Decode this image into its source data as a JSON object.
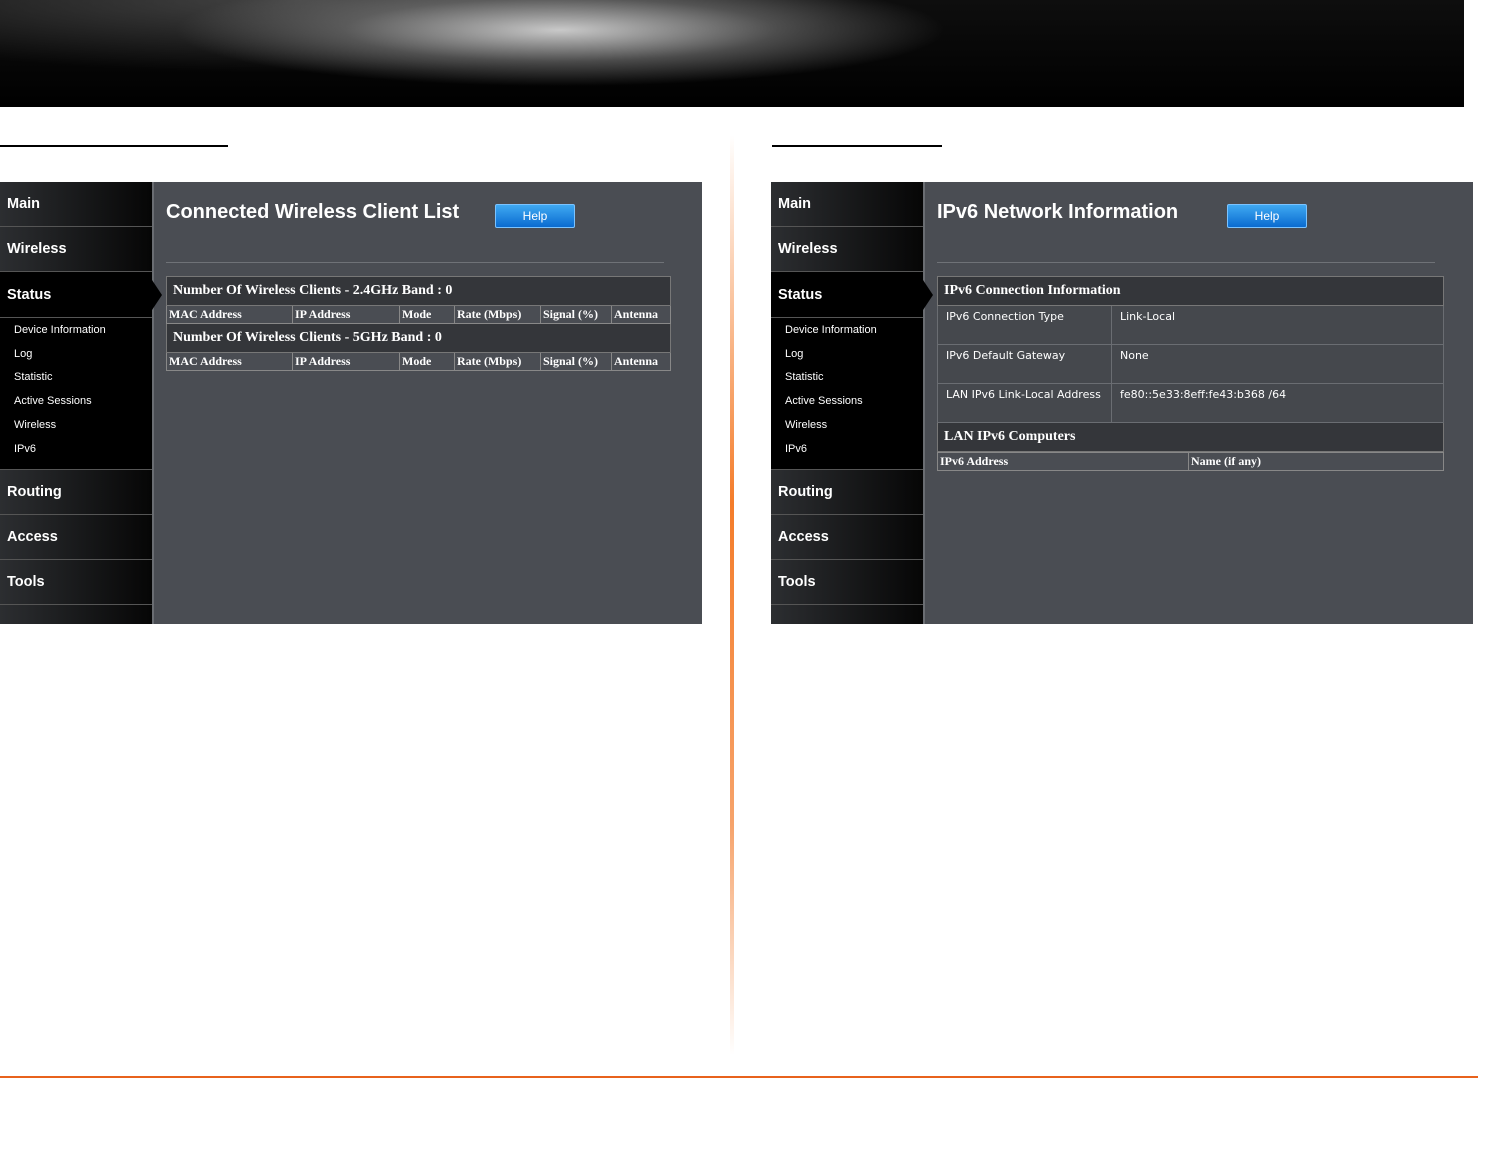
{
  "nav": {
    "main": "Main",
    "wireless": "Wireless",
    "status": "Status",
    "routing": "Routing",
    "access": "Access",
    "tools": "Tools",
    "status_sub": [
      "Device Information",
      "Log",
      "Statistic",
      "Active Sessions",
      "Wireless",
      "IPv6"
    ]
  },
  "left": {
    "title": "Connected Wireless Client List",
    "help": "Help",
    "band24": "Number Of Wireless Clients - 2.4GHz Band : 0",
    "band5": "Number Of Wireless Clients - 5GHz Band : 0",
    "columns": [
      "MAC Address",
      "IP Address",
      "Mode",
      "Rate (Mbps)",
      "Signal (%)",
      "Antenna"
    ]
  },
  "right": {
    "title": "IPv6 Network Information",
    "help": "Help",
    "conn_header": "IPv6 Connection Information",
    "rows": [
      {
        "label": "IPv6 Connection Type",
        "value": "Link-Local"
      },
      {
        "label": "IPv6 Default Gateway",
        "value": "None"
      },
      {
        "label": "LAN IPv6 Link-Local Address",
        "value": "fe80::5e33:8eff:fe43:b368 /64"
      }
    ],
    "computers_header": "LAN IPv6 Computers",
    "computer_columns": [
      "IPv6 Address",
      "Name (if any)"
    ]
  },
  "colors": {
    "accent_orange": "#e8621c",
    "help_blue": "#1a84e0",
    "panel_bg": "#4a4d53"
  }
}
